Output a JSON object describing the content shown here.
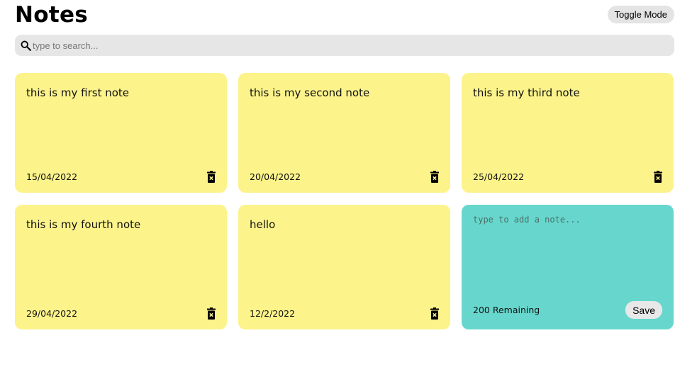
{
  "header": {
    "title": "Notes",
    "toggle_label": "Toggle Mode"
  },
  "search": {
    "placeholder": "type to search...",
    "value": "",
    "icon": "search-icon"
  },
  "notes": [
    {
      "text": "this is my first note",
      "date": "15/04/2022",
      "delete_icon": "trash-icon"
    },
    {
      "text": "this is my second note",
      "date": "20/04/2022",
      "delete_icon": "trash-icon"
    },
    {
      "text": "this is my third note",
      "date": "25/04/2022",
      "delete_icon": "trash-icon"
    },
    {
      "text": "this is my fourth note",
      "date": "29/04/2022",
      "delete_icon": "trash-icon"
    },
    {
      "text": "hello",
      "date": "12/2/2022",
      "delete_icon": "trash-icon"
    }
  ],
  "new_note": {
    "placeholder": "type to add a note...",
    "value": "",
    "remaining_label": "200 Remaining",
    "save_label": "Save"
  },
  "colors": {
    "note_bg": "#fcf38b",
    "new_note_bg": "#67d7cd",
    "search_bg": "#e6e6e6",
    "button_bg": "#e4e4e4"
  }
}
